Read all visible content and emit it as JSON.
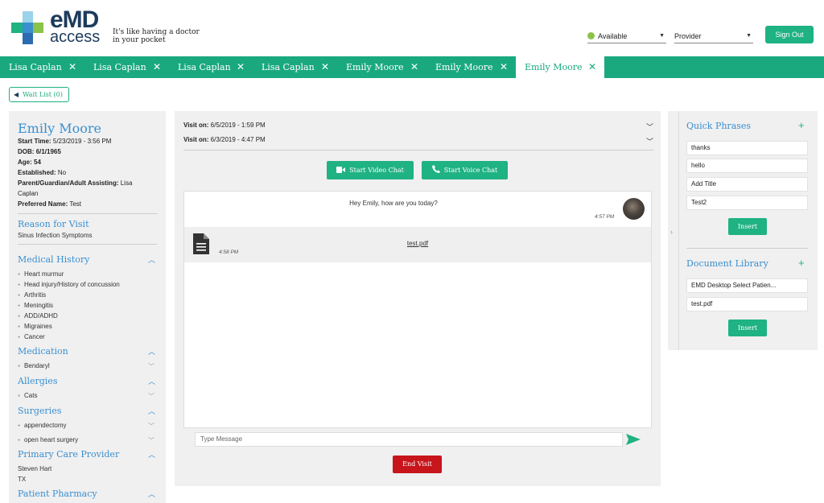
{
  "header": {
    "brand_emd": "eMD",
    "brand_access": "access",
    "tagline": "It's like having a doctor in your pocket",
    "status": "Available",
    "role": "Provider",
    "signout_label": "Sign Out"
  },
  "tabs": [
    {
      "label": "Lisa Caplan",
      "close": "✕"
    },
    {
      "label": "Lisa Caplan",
      "close": "✕"
    },
    {
      "label": "Lisa Caplan",
      "close": "✕"
    },
    {
      "label": "Lisa Caplan",
      "close": "✕"
    },
    {
      "label": "Emily Moore",
      "close": "✕"
    },
    {
      "label": "Emily Moore",
      "close": "✕"
    },
    {
      "label": "Emily Moore",
      "close": "✕",
      "active": true
    }
  ],
  "waitlist_label": "Wait List (0)",
  "patient": {
    "name": "Emily Moore",
    "start_time_label": "Start Time:",
    "start_time": "5/23/2019 - 3:56 PM",
    "dob_label": "DOB:",
    "dob": "6/1/1965",
    "age_label": "Age:",
    "age": "54",
    "established_label": "Established:",
    "established": "No",
    "guardian_label": "Parent/Guardian/Adult Assisting:",
    "guardian_part1": "Lisa",
    "guardian_part2": "Caplan",
    "preferred_label": "Preferred Name:",
    "preferred": "Test"
  },
  "sections": {
    "reason_head": "Reason for Visit",
    "reason": "Sinus Infection Symptoms",
    "medical_history_head": "Medical History",
    "medical_history": [
      "Heart murmur",
      "Head injury/History of concussion",
      "Arthritis",
      "Meningitis",
      "ADD/ADHD",
      "Migraines",
      "Cancer"
    ],
    "medication_head": "Medication",
    "medication": [
      "Bendaryl"
    ],
    "allergies_head": "Allergies",
    "allergies": [
      "Cats"
    ],
    "surgeries_head": "Surgeries",
    "surgeries": [
      "appendectomy",
      "open heart surgery"
    ],
    "pcp_head": "Primary Care Provider",
    "pcp_name": "Steven Hart",
    "pcp_state": "TX",
    "pharmacy_head": "Patient Pharmacy"
  },
  "visits": [
    {
      "label": "Visit on:",
      "date": "6/5/2019 - 1:59 PM"
    },
    {
      "label": "Visit on:",
      "date": "6/3/2019 - 4:47 PM"
    }
  ],
  "buttons": {
    "video": "Start Video Chat",
    "voice": "Start Voice Chat",
    "end_visit": "End Visit"
  },
  "messages": [
    {
      "text": "Hey Emily, how are you today?",
      "time": "4:57 PM"
    },
    {
      "file": "test.pdf",
      "time": "4:58 PM"
    }
  ],
  "message_placeholder": "Type Message",
  "quick_phrases": {
    "head": "Quick Phrases",
    "items": [
      "thanks",
      "hello",
      "Add Title",
      "Test2"
    ],
    "insert": "Insert"
  },
  "document_library": {
    "head": "Document Library",
    "items": [
      "EMD Desktop Select Patien...",
      "test.pdf"
    ],
    "insert": "Insert"
  },
  "colors": {
    "accent": "#1aa97f",
    "link_blue": "#3a8fd0",
    "danger": "#c8141b",
    "brand_navy": "#1d3b5c"
  }
}
